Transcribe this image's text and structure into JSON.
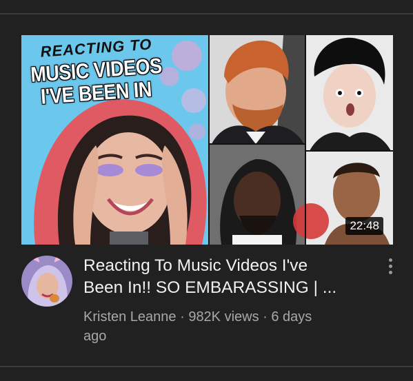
{
  "video": {
    "thumbnail_text": {
      "line1": "REACTING TO",
      "line2": "MUSIC VIDEOS",
      "line3": "I'VE BEEN IN"
    },
    "duration": "22:48",
    "title_line1": "Reacting To Music Videos I've",
    "title_line2": "Been In!! SO EMBARASSING  | ...",
    "meta_line1": "Kristen Leanne · 982K views · 6 days",
    "meta_line2": "ago"
  },
  "icons": {
    "more": "more-vert-icon"
  },
  "colors": {
    "background": "#212121",
    "title_text": "#f1f1f1",
    "meta_text": "#a8a8a8",
    "thumb_hood": "#e8575c",
    "thumb_sky": "#5fc4ea"
  }
}
